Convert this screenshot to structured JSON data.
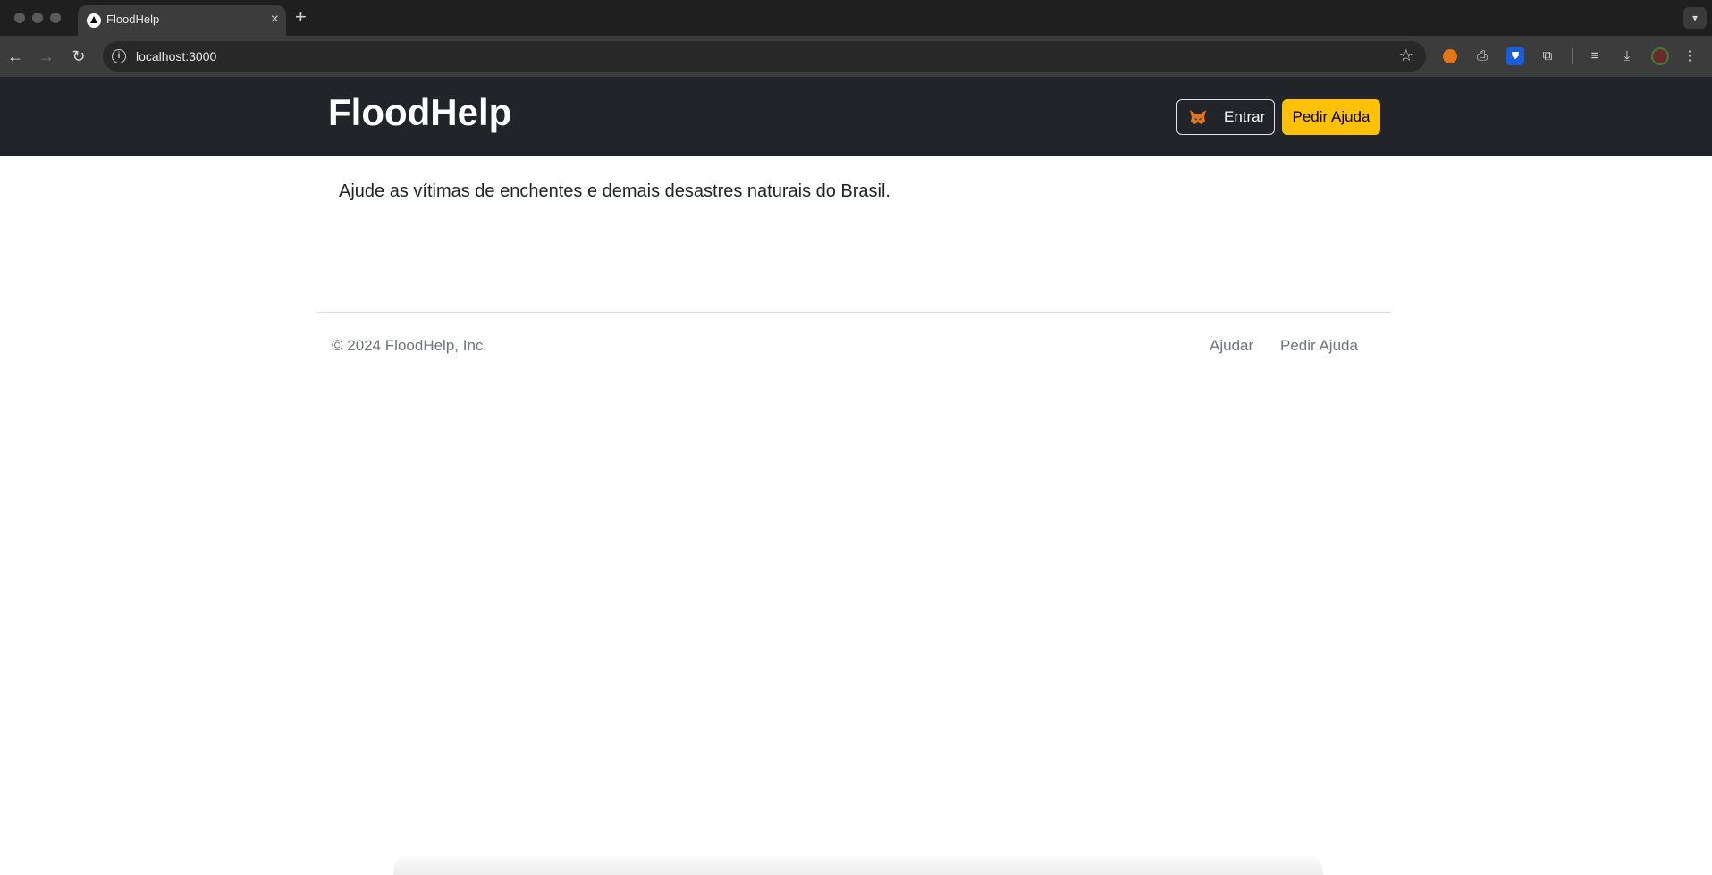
{
  "browser": {
    "tab_title": "FloodHelp",
    "url": "localhost:3000",
    "new_tab_glyph": "+",
    "close_glyph": "×"
  },
  "navbar": {
    "brand": "FloodHelp",
    "login_label": "Entrar",
    "request_help_label": "Pedir Ajuda"
  },
  "main": {
    "lead": "Ajude as vítimas de enchentes e demais desastres naturais do Brasil."
  },
  "footer": {
    "copyright": "© 2024 FloodHelp, Inc.",
    "links": [
      "Ajudar",
      "Pedir Ajuda"
    ]
  },
  "colors": {
    "navbar_bg": "#212529",
    "accent_warning": "#ffc107",
    "muted_text": "#6c757d"
  },
  "icons": [
    "back-arrow-icon",
    "forward-arrow-icon",
    "reload-icon",
    "info-icon",
    "star-icon",
    "metamask-fox-icon",
    "bitwarden-shield-icon",
    "extensions-puzzle-icon",
    "download-icon"
  ]
}
